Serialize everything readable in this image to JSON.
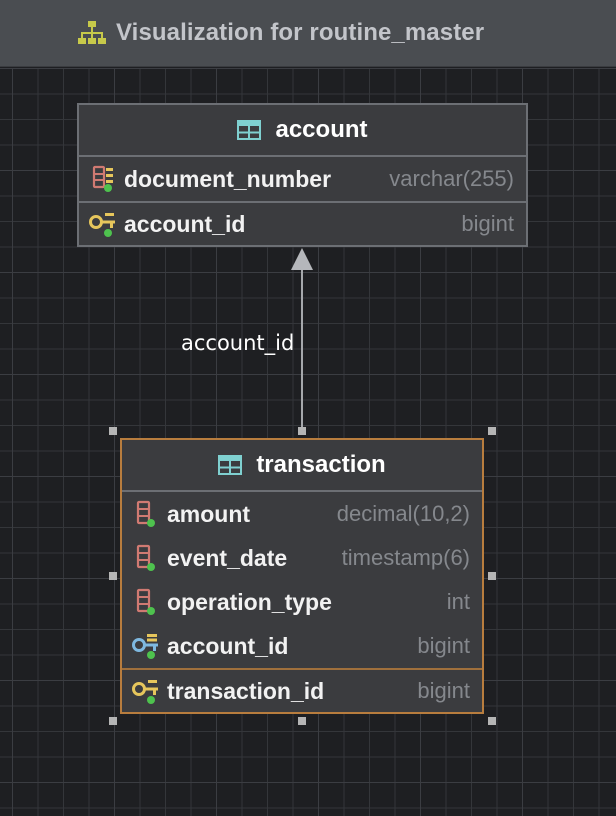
{
  "window": {
    "title": "Visualization for routine_master",
    "title_icon": "hierarchy-diagram-icon"
  },
  "tables": {
    "account": {
      "name": "account",
      "columns": [
        {
          "name": "document_number",
          "type": "varchar(255)",
          "icon": "indexed-column-icon"
        },
        {
          "name": "account_id",
          "type": "bigint",
          "icon": "primary-key-icon"
        }
      ]
    },
    "transaction": {
      "name": "transaction",
      "columns": [
        {
          "name": "amount",
          "type": "decimal(10,2)",
          "icon": "column-icon"
        },
        {
          "name": "event_date",
          "type": "timestamp(6)",
          "icon": "column-icon"
        },
        {
          "name": "operation_type",
          "type": "int",
          "icon": "column-icon"
        },
        {
          "name": "account_id",
          "type": "bigint",
          "icon": "foreign-key-icon"
        },
        {
          "name": "transaction_id",
          "type": "bigint",
          "icon": "primary-key-icon"
        }
      ]
    }
  },
  "relations": [
    {
      "from": "transaction",
      "to": "account",
      "label": "account_id"
    }
  ],
  "colors": {
    "background": "#1e1f22",
    "titlebar": "#4a4d51",
    "table_fill": "#3b3c3f",
    "selected_border": "#b87d3e",
    "primary_key": "#e6c65c",
    "foreign_key": "#7fb9e0",
    "column": "#d07a72",
    "table_icon": "#7fd0d0",
    "not_null_dot": "#4ec24e"
  }
}
